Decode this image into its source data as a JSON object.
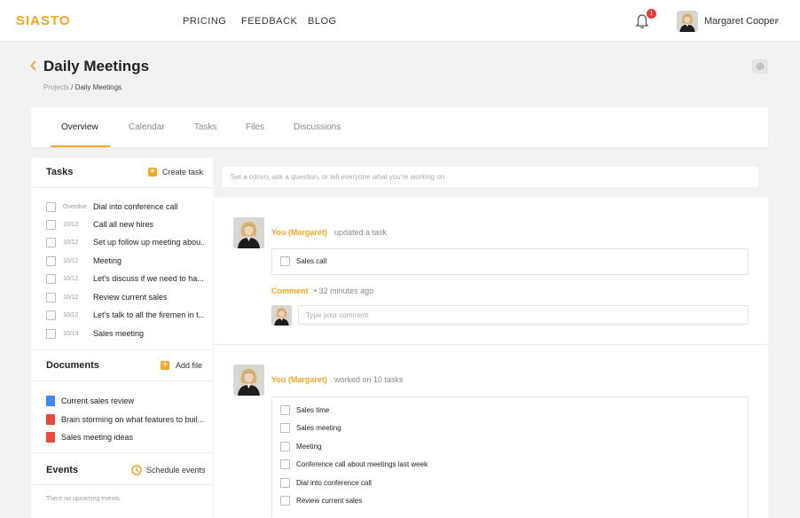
{
  "brand": {
    "logo": "SIASTO",
    "accent": "#f5a623"
  },
  "nav": {
    "pricing": "PRICING",
    "feedback": "FEEDBACK",
    "blog": "BLOG"
  },
  "notifications": {
    "count": "1"
  },
  "user": {
    "name": "Margaret Cooper"
  },
  "page": {
    "title": "Daily Meetings",
    "breadcrumb_parent": "Projects",
    "breadcrumb_sep": " / ",
    "breadcrumb_current": "Daily Meetings"
  },
  "tabs": [
    {
      "label": "Overview",
      "active": true
    },
    {
      "label": "Calendar"
    },
    {
      "label": "Tasks"
    },
    {
      "label": "Files"
    },
    {
      "label": "Discussions"
    }
  ],
  "sidebar": {
    "tasks_title": "Tasks",
    "create_task": "Create task",
    "tasks": [
      {
        "date": "Overdue",
        "label": "Dial into conference call"
      },
      {
        "date": "10/12",
        "label": "Call all new hires"
      },
      {
        "date": "10/12",
        "label": "Set up follow up meeting abou..."
      },
      {
        "date": "10/12",
        "label": "Meeting"
      },
      {
        "date": "10/12",
        "label": "Let's discuss if we need to ha..."
      },
      {
        "date": "10/12",
        "label": "Review current sales"
      },
      {
        "date": "10/12",
        "label": "Let's talk to all the firemen in t..."
      },
      {
        "date": "10/13",
        "label": "Sales meeting"
      }
    ],
    "documents_title": "Documents",
    "add_file": "Add file",
    "documents": [
      {
        "type": "doc",
        "label": "Current sales review"
      },
      {
        "type": "pdf",
        "label": "Brain storming on what features to buil..."
      },
      {
        "type": "pdf",
        "label": "Sales meeting ideas"
      }
    ],
    "events_title": "Events",
    "schedule_events": "Schedule events",
    "no_events": "There no upcoming events."
  },
  "composer": {
    "placeholder": "Set a convo, ask a question, or tell everyone what you're working on"
  },
  "feed": [
    {
      "actor": "You (Margaret)",
      "action": "updated a task",
      "tasks": [
        "Sales call"
      ],
      "comment_label": "Comment",
      "comment_meta": "•  32 minutes ago",
      "comment_placeholder": "Type your comment"
    },
    {
      "actor": "You (Margaret)",
      "action": "worked on 10 tasks",
      "tasks": [
        "Sales time",
        "Sales meeting",
        "Meeting",
        "Conference call about meetings last week",
        "Dial into conference call",
        "Review current sales"
      ]
    }
  ]
}
